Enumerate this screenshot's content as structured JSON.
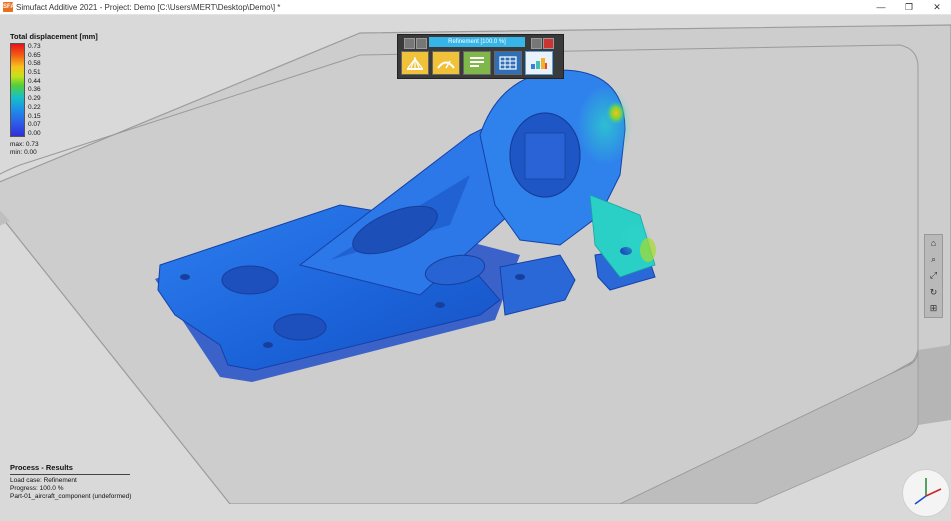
{
  "window": {
    "title": "Simufact Additive 2021 - Project: Demo [C:\\Users\\MERT\\Desktop\\Demo\\] *",
    "app_icon_text": "SFA",
    "controls": [
      "—",
      "❐",
      "✕"
    ]
  },
  "legend": {
    "title": "Total displacement [mm]",
    "ticks": [
      "0.73",
      "0.65",
      "0.58",
      "0.51",
      "0.44",
      "0.36",
      "0.29",
      "0.22",
      "0.15",
      "0.07",
      "0.00"
    ],
    "max_label": "max:",
    "max_value": "0.73",
    "min_label": "min:",
    "min_value": "0.00"
  },
  "toolbar": {
    "progress_label": "Refinement [100.0 %]",
    "icons": [
      "sun-rays-icon",
      "gauge-icon",
      "list-icon",
      "table-icon",
      "heatmap-icon"
    ]
  },
  "nav": {
    "buttons": [
      "home-icon",
      "zoom-icon",
      "fit-icon",
      "rotate-icon",
      "zoom-box-icon"
    ]
  },
  "info": {
    "title": "Process - Results",
    "load_case": "Load case: Refinement",
    "progress": "Progress: 100.0 %",
    "part": "Part-01_aircraft_component (undeformed)"
  },
  "colors": {
    "plate": "#c8c8c8",
    "plate_edge": "#a9a9a9",
    "part_blue": "#1f6fe0",
    "accent": "#36b6e8"
  }
}
